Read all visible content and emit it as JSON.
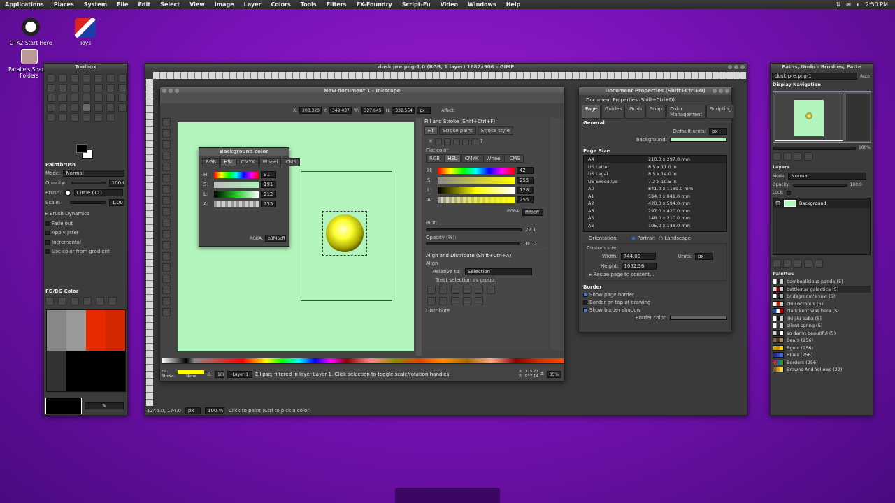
{
  "topbar": {
    "menus": [
      "Applications",
      "Places",
      "System",
      "File",
      "Edit",
      "Select",
      "View",
      "Image",
      "Layer",
      "Colors",
      "Tools",
      "Filters",
      "FX-Foundry",
      "Script-Fu",
      "Video",
      "Windows",
      "Help"
    ],
    "time": "2:50 PM"
  },
  "desktop": {
    "icons": [
      "GTK2 Start Here",
      "Toys",
      "Parallels Shared Folders"
    ]
  },
  "toolbox": {
    "title": "Toolbox",
    "tool_options_title": "Paintbrush",
    "mode_label": "Mode:",
    "mode_value": "Normal",
    "opacity_label": "Opacity:",
    "opacity_value": "100.0",
    "brush_label": "Brush:",
    "brush_value": "Circle (11)",
    "scale_label": "Scale:",
    "scale_value": "1.00",
    "options": [
      "Brush Dynamics",
      "Fade out",
      "Apply Jitter",
      "Incremental",
      "Use color from gradient"
    ],
    "fgbg_title": "FG/BG Color"
  },
  "gimp": {
    "title": "dusk pre.png-1.0 (RGB, 1 layer) 1682x906 – GIMP",
    "coords": "1245.0, 174.0",
    "unit": "px",
    "zoom": "100 %",
    "status": "Click to paint (Ctrl to pick a color)"
  },
  "inkscape": {
    "title": "New document 1 - Inkscape",
    "toolbar": {
      "x_label": "X:",
      "x": "203.320",
      "y_label": "Y:",
      "y": "349.437",
      "w_label": "W:",
      "w": "327.645",
      "h_label": "H:",
      "h": "332.554",
      "unit": "px",
      "affect": "Affect:"
    },
    "bg_dialog": {
      "title": "Background color",
      "tabs": [
        "RGB",
        "HSL",
        "CMYK",
        "Wheel",
        "CMS"
      ],
      "channels": [
        {
          "label": "H:",
          "value": "91"
        },
        {
          "label": "S:",
          "value": "191"
        },
        {
          "label": "L:",
          "value": "212"
        },
        {
          "label": "A:",
          "value": "255"
        }
      ],
      "rgba_label": "RGBA:",
      "rgba": "b3f4bcff"
    },
    "fill_stroke": {
      "title": "Fill and Stroke (Shift+Ctrl+F)",
      "tabs": [
        "Fill",
        "Stroke paint",
        "Stroke style"
      ],
      "flat_color": "Flat color",
      "color_tabs": [
        "RGB",
        "HSL",
        "CMYK",
        "Wheel",
        "CMS"
      ],
      "channels": [
        {
          "label": "H:",
          "value": "42"
        },
        {
          "label": "S:",
          "value": "255"
        },
        {
          "label": "L:",
          "value": "128"
        },
        {
          "label": "A:",
          "value": "255"
        }
      ],
      "rgba_label": "RGBA:",
      "rgba": "ffff00ff",
      "blur_label": "Blur:",
      "blur": "27.1",
      "opacity_label": "Opacity (%):",
      "opacity": "100.0"
    },
    "align": {
      "title": "Align and Distribute (Shift+Ctrl+A)",
      "align_label": "Align",
      "relative_label": "Relative to:",
      "relative_value": "Selection",
      "treat_label": "Treat selection as group:",
      "distribute_label": "Distribute"
    },
    "status": {
      "fill_label": "Fill:",
      "stroke_label": "Stroke:",
      "stroke_value": "None",
      "o_label": "O:",
      "o_value": "10(",
      "layer": "•Layer 1",
      "message": "Ellipse; filtered in layer Layer 1. Click selection to toggle scale/rotation handles.",
      "x_label": "X:",
      "x": "125.71",
      "y_label": "Y:",
      "y": "937.14",
      "z_label": "Z:",
      "zoom": "35%"
    }
  },
  "docprops": {
    "title": "Document Properties (Shift+Ctrl+D)",
    "subtitle": "Document Properties (Shift+Ctrl+D)",
    "tabs": [
      "Page",
      "Guides",
      "Grids",
      "Snap",
      "Color Management",
      "Scripting"
    ],
    "general": "General",
    "default_units_label": "Default units:",
    "default_units": "px",
    "background_label": "Background:",
    "page_size_label": "Page Size",
    "sizes": [
      {
        "name": "A4",
        "dim": "210.0 x 297.0 mm"
      },
      {
        "name": "US Letter",
        "dim": "8.5 x 11.0 in"
      },
      {
        "name": "US Legal",
        "dim": "8.5 x 14.0 in"
      },
      {
        "name": "US Executive",
        "dim": "7.2 x 10.5 in"
      },
      {
        "name": "A0",
        "dim": "841.0 x 1189.0 mm"
      },
      {
        "name": "A1",
        "dim": "594.0 x 841.0 mm"
      },
      {
        "name": "A2",
        "dim": "420.0 x 594.0 mm"
      },
      {
        "name": "A3",
        "dim": "297.0 x 420.0 mm"
      },
      {
        "name": "A5",
        "dim": "148.0 x 210.0 mm"
      },
      {
        "name": "A6",
        "dim": "105.0 x 148.0 mm"
      }
    ],
    "orientation_label": "Orientation:",
    "portrait": "Portrait",
    "landscape": "Landscape",
    "custom_size": "Custom size",
    "width_label": "Width:",
    "width": "744.09",
    "height_label": "Height:",
    "height": "1052.36",
    "units_label": "Units:",
    "units": "px",
    "resize": "Resize page to content...",
    "border_label": "Border",
    "show_border": "Show page border",
    "border_top": "Border on top of drawing",
    "border_shadow": "Show border shadow",
    "border_color_label": "Border color:"
  },
  "right_dock": {
    "title": "Paths, Undo - Brushes, Patte",
    "image_select": "dusk pre.png-1",
    "auto": "Auto",
    "nav_title": "Display Navigation",
    "nav_zoom": "100%",
    "layers_title": "Layers",
    "mode_label": "Mode:",
    "mode": "Normal",
    "opacity_label": "Opacity:",
    "opacity": "100.0",
    "lock_label": "Lock:",
    "layer_name": "Background",
    "palettes_title": "Palettes",
    "palettes": [
      {
        "name": "bamboolicious panda (5)",
        "colors": [
          "#fff",
          "#222",
          "#ccc"
        ]
      },
      {
        "name": "battlestar galactica (5)",
        "colors": [
          "#ddd",
          "#8a0000",
          "#ccc"
        ]
      },
      {
        "name": "bridegroom's vow (5)",
        "colors": [
          "#fff",
          "#222",
          "#aaa"
        ]
      },
      {
        "name": "chili octopus (5)",
        "colors": [
          "#fff",
          "#cc2200",
          "#ccc"
        ]
      },
      {
        "name": "clark kent was here (5)",
        "colors": [
          "#1a4fbf",
          "#fff",
          "#c00"
        ]
      },
      {
        "name": "jiki jiki baba (5)",
        "colors": [
          "#fff",
          "#111",
          "#ccc"
        ]
      },
      {
        "name": "silent spring (5)",
        "colors": [
          "#fff",
          "#333",
          "#ddd"
        ]
      },
      {
        "name": "so damn beautiful (5)",
        "colors": [
          "#ccc",
          "#222",
          "#fff"
        ]
      },
      {
        "name": "Bears (256)",
        "colors": [
          "#7a5a3a",
          "#4a3a2a",
          "#aa8866"
        ]
      },
      {
        "name": "Bgold (256)",
        "colors": [
          "#d4a800",
          "#c89000",
          "#ffd000"
        ]
      },
      {
        "name": "Blues (256)",
        "colors": [
          "#1a2a8a",
          "#3344aa",
          "#4466cc"
        ]
      },
      {
        "name": "Borders (256)",
        "colors": [
          "#c02020",
          "#2060c0",
          "#20a020"
        ]
      },
      {
        "name": "Browns And Yellows (22)",
        "colors": [
          "#8a5a20",
          "#d4a020",
          "#ffd040"
        ]
      }
    ]
  },
  "colors": {
    "desktop": "#7a12b8",
    "canvas_green": "#b3f4bc",
    "yellow": "#ffff00",
    "fg": "#000000",
    "bg": "#ffffff"
  }
}
